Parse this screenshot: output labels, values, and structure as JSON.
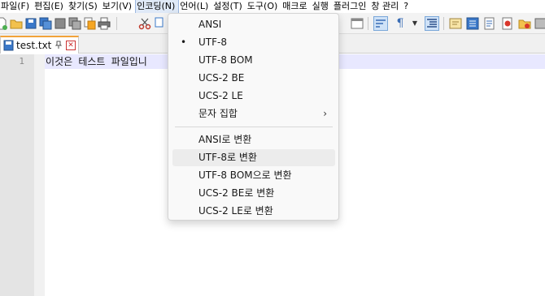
{
  "menubar": {
    "items": [
      "파일(F)",
      "편집(E)",
      "찾기(S)",
      "보기(V)",
      "인코딩(N)",
      "언어(L)",
      "설정(T)",
      "도구(O)",
      "매크로",
      "실행",
      "플러그인",
      "창 관리",
      "?"
    ]
  },
  "tab": {
    "title": "test.txt",
    "pin_icon": "📌",
    "close_icon": "✕"
  },
  "editor": {
    "line_number": "1",
    "line_text": "이것은 테스트 파일입니"
  },
  "encoding_menu": {
    "items": [
      {
        "label": "ANSI",
        "bullet": ""
      },
      {
        "label": "UTF-8",
        "bullet": "•"
      },
      {
        "label": "UTF-8 BOM",
        "bullet": ""
      },
      {
        "label": "UCS-2 BE",
        "bullet": ""
      },
      {
        "label": "UCS-2 LE",
        "bullet": ""
      },
      {
        "label": "문자 집합",
        "bullet": "",
        "submenu": "›"
      }
    ],
    "convert_items": [
      {
        "label": "ANSI로 변환"
      },
      {
        "label": "UTF-8로 변환"
      },
      {
        "label": "UTF-8 BOM으로 변환"
      },
      {
        "label": "UCS-2 BE로 변환"
      },
      {
        "label": "UCS-2 LE로 변환"
      }
    ]
  },
  "toolbar": {
    "pilcrow": "¶",
    "arrow": "▼"
  }
}
